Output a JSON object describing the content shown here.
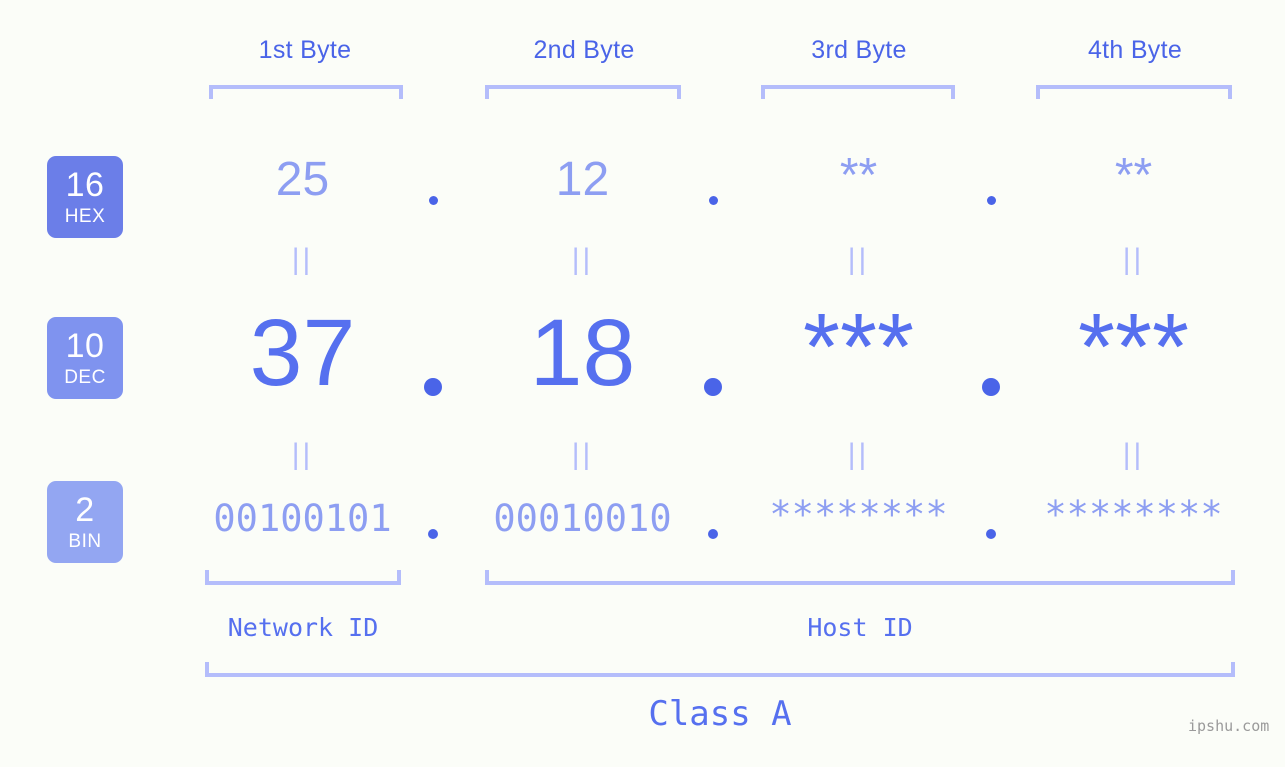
{
  "page": {
    "background_color": "#fbfdf8",
    "accent_color": "#5670ef",
    "light_accent_color": "#8d9ef2",
    "bracket_color": "#b4bdfb",
    "watermark": "ipshu.com"
  },
  "byte_headers": [
    {
      "label": "1st Byte"
    },
    {
      "label": "2nd Byte"
    },
    {
      "label": "3rd Byte"
    },
    {
      "label": "4th Byte"
    }
  ],
  "bases": [
    {
      "number": "16",
      "name": "HEX",
      "color": "#6b7ee8"
    },
    {
      "number": "10",
      "name": "DEC",
      "color": "#7f93ef"
    },
    {
      "number": "2",
      "name": "BIN",
      "color": "#93a6f2"
    }
  ],
  "rows": {
    "hex": {
      "base": "16",
      "values": [
        "25",
        "12",
        "**",
        "**"
      ]
    },
    "dec": {
      "base": "10",
      "values": [
        "37",
        "18",
        "***",
        "***"
      ]
    },
    "bin": {
      "base": "2",
      "values": [
        "00100101",
        "00010010",
        "********",
        "********"
      ]
    }
  },
  "separator": ".",
  "equality_symbol": "||",
  "id_sections": [
    {
      "label": "Network ID"
    },
    {
      "label": "Host ID"
    }
  ],
  "class_label": "Class A"
}
